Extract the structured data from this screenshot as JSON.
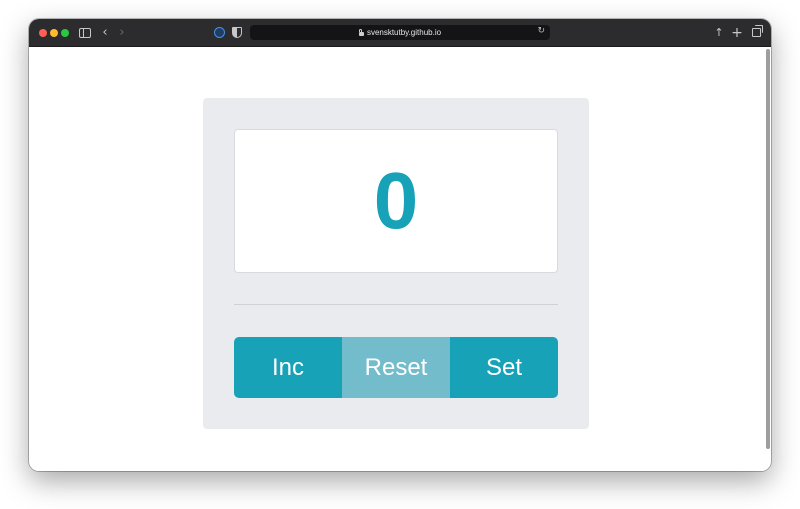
{
  "browser": {
    "address": "svensktutby.github.io"
  },
  "counter": {
    "value": "0"
  },
  "buttons": {
    "inc_label": "Inc",
    "reset_label": "Reset",
    "set_label": "Set"
  },
  "colors": {
    "accent": "#17a2b8",
    "reset_button": "#73bccb",
    "card_background": "#e9ebee"
  },
  "icons": [
    "sidebar-icon",
    "back-icon",
    "forward-icon",
    "extension-icon",
    "shield-icon",
    "lock-icon",
    "reload-icon",
    "share-icon",
    "new-tab-icon",
    "tabs-overview-icon"
  ]
}
